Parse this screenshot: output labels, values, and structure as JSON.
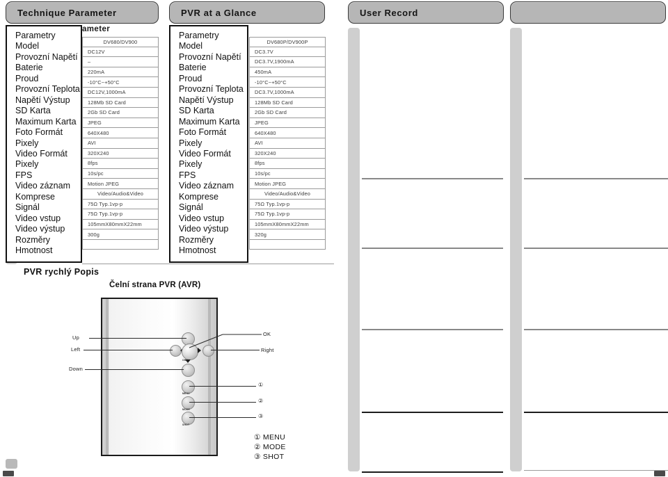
{
  "panels": [
    {
      "id": "technique-parameter",
      "title": "Technique Parameter"
    },
    {
      "id": "pvr-at-a-glance",
      "title": "PVR at a Glance"
    },
    {
      "id": "user-record",
      "title": "User Record"
    },
    {
      "id": "user-record-2",
      "title": ""
    }
  ],
  "spec": {
    "header_text": "ameter",
    "label_column_title": "Parametry",
    "labels": [
      "Model",
      "Provozní Napětí",
      "Baterie",
      "Proud",
      "Provozní Teplota",
      "Napětí Výstup",
      "SD Karta",
      "Maximum Karta",
      "Foto Formát",
      "Pixely",
      "Video Formát",
      "Pixely",
      "FPS",
      "Video záznam",
      "Komprese",
      "Signál",
      "Video vstup",
      "Video výstup",
      "Rozměry",
      "Hmotnost"
    ],
    "column_a": {
      "header": "DV680/DV900",
      "values": [
        "DV680/DV900",
        "DC12V",
        "–",
        "220mA",
        "-10°C~+50°C",
        "DC12V,1000mA",
        "128Mb SD Card",
        "2Gb SD Card",
        "JPEG",
        "640X480",
        "AVI",
        "320X240",
        "8fps",
        "10s/pc",
        "Motion JPEG",
        "Video/Audio&Video",
        "75Ω Typ.1vp-p",
        "75Ω Typ.1vp-p",
        "105mmX80mmX22mm",
        "300g"
      ]
    },
    "column_b": {
      "header": "DV680P/DV900P",
      "values": [
        "DV680P/DV900P",
        "DC3.7V",
        "DC3.7V,1900mA",
        "450mA",
        "-10°C~+50°C",
        "DC3.7V,1000mA",
        "128Mb SD Card",
        "2Gb SD Card",
        "JPEG",
        "640X480",
        "AVI",
        "320X240",
        "8fps",
        "10s/pc",
        "Motion JPEG",
        "Video/Audio&Video",
        "75Ω Typ.1vp-p",
        "75Ω Typ.1vp-p",
        "105mmX80mmX22mm",
        "320g"
      ]
    }
  },
  "quick_guide": {
    "section_title": "PVR rychlý Popis",
    "figure_title": "Čelní strana PVR (AVR)",
    "callouts": {
      "up": "Up",
      "left": "Left",
      "down": "Down",
      "ok": "OK",
      "right": "Right",
      "num1": "①",
      "num2": "②",
      "num3": "③"
    },
    "knob_labels": {
      "ok": "OK",
      "menu": "MENU",
      "mode": "MODE",
      "shot": "SHOT"
    },
    "legend": [
      "① MENU",
      "② MODE",
      "③ SHOT"
    ]
  },
  "colors": {
    "pill_fill": "#b6b6b6",
    "pill_border": "#3a3a3a",
    "gutter": "#cfcfcf",
    "rule": "#888888",
    "rule_dark": "#1c1c1c",
    "text": "#111111"
  }
}
